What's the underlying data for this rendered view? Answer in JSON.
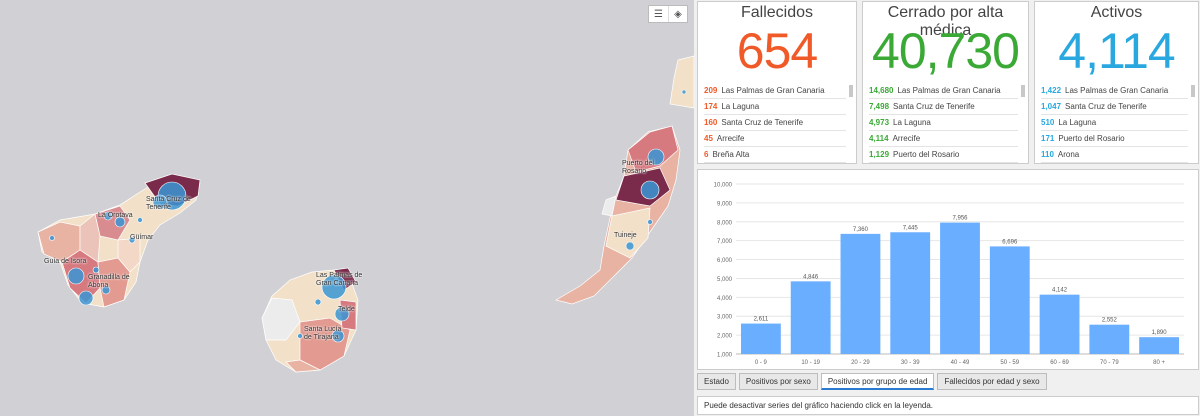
{
  "map": {
    "tools": [
      {
        "name": "legend-icon",
        "glyph": "☰"
      },
      {
        "name": "layers-icon",
        "glyph": "◈"
      }
    ],
    "labels": [
      "Santa Cruz de Tenerife",
      "La Orotava",
      "Güímar",
      "Guía de Isora",
      "Granadilla de Abona",
      "Las Palmas de Gran Canaria",
      "Telde",
      "Santa Lucía de Tirajana",
      "Puerto del Rosario",
      "Tuineje"
    ],
    "colors": {
      "water": "#d1d0d4",
      "bubble": "#3a95d3"
    }
  },
  "cards": [
    {
      "title": "Fallecidos",
      "value": "654",
      "color": "#f05a28",
      "items": [
        {
          "num": "209",
          "name": "Las Palmas de Gran Canaria"
        },
        {
          "num": "174",
          "name": "La Laguna"
        },
        {
          "num": "160",
          "name": "Santa Cruz de Tenerife"
        },
        {
          "num": "45",
          "name": "Arrecife"
        },
        {
          "num": "6",
          "name": "Breña Alta"
        }
      ]
    },
    {
      "title": "Cerrado por alta médica",
      "value": "40,730",
      "color": "#3aa935",
      "items": [
        {
          "num": "14,680",
          "name": "Las Palmas de Gran Canaria"
        },
        {
          "num": "7,498",
          "name": "Santa Cruz de Tenerife"
        },
        {
          "num": "4,973",
          "name": "La Laguna"
        },
        {
          "num": "4,114",
          "name": "Arrecife"
        },
        {
          "num": "1,129",
          "name": "Puerto del Rosario"
        }
      ]
    },
    {
      "title": "Activos",
      "value": "4,114",
      "color": "#29a8e0",
      "items": [
        {
          "num": "1,422",
          "name": "Las Palmas de Gran Canaria"
        },
        {
          "num": "1,047",
          "name": "Santa Cruz de Tenerife"
        },
        {
          "num": "510",
          "name": "La Laguna"
        },
        {
          "num": "171",
          "name": "Puerto del Rosario"
        },
        {
          "num": "110",
          "name": "Arona"
        }
      ]
    }
  ],
  "chart_data": {
    "type": "bar",
    "categories": [
      "0 - 9",
      "10 - 19",
      "20 - 29",
      "30 - 39",
      "40 - 49",
      "50 - 59",
      "60 - 69",
      "70 - 79",
      "80 +"
    ],
    "values": [
      2611,
      4846,
      7360,
      7445,
      7956,
      6696,
      4142,
      2552,
      1890
    ],
    "value_labels": [
      "2,611",
      "4,846",
      "7,360",
      "7,445",
      "7,956",
      "6,696",
      "4,142",
      "2,552",
      "1,890"
    ],
    "yticks": [
      "1,000",
      "2,000",
      "3,000",
      "4,000",
      "5,000",
      "6,000",
      "7,000",
      "8,000",
      "9,000",
      "10,000"
    ],
    "ylim": [
      1000,
      10000
    ],
    "bar_color": "#6aaeff",
    "grid": true,
    "title": "",
    "xlabel": "",
    "ylabel": ""
  },
  "tabs": [
    {
      "label": "Estado",
      "active": false
    },
    {
      "label": "Positivos por sexo",
      "active": false
    },
    {
      "label": "Positivos por grupo de edad",
      "active": true
    },
    {
      "label": "Fallecidos por edad y sexo",
      "active": false
    }
  ],
  "legend_note": "Puede desactivar series del gráfico haciendo click en la leyenda."
}
